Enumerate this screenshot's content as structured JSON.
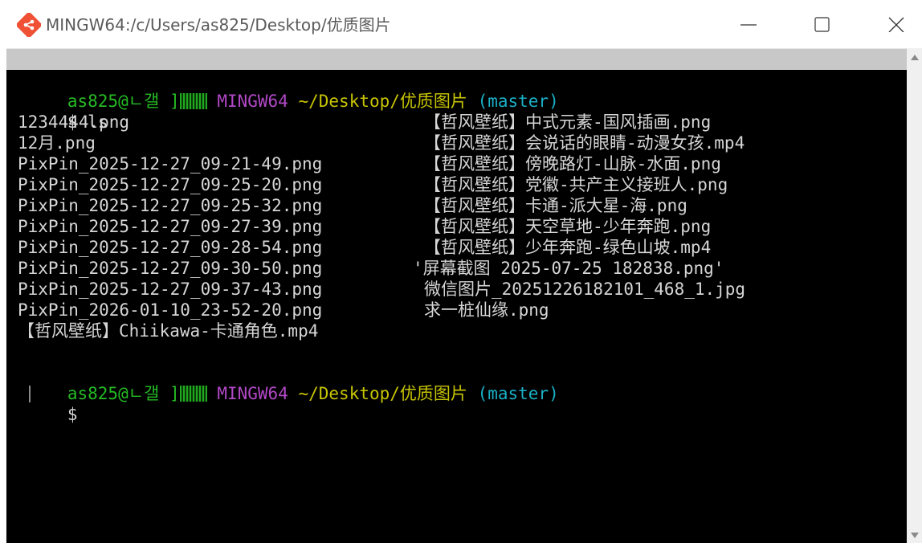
{
  "window": {
    "title": "MINGW64:/c/Users/as825/Desktop/优质图片"
  },
  "prompt": {
    "user_host": "as825@ㄴ갤 ]",
    "system": "MINGW64",
    "path": "~/Desktop/优质图片",
    "branch": "(master)",
    "symbol": "$"
  },
  "command": "ls",
  "listing": {
    "rows": [
      {
        "a": "1234444.png",
        "b": "【哲风壁纸】中式元素-国风插画.png"
      },
      {
        "a": "12月.png",
        "b": "【哲风壁纸】会说话的眼睛-动漫女孩.mp4"
      },
      {
        "a": "PixPin_2025-12-27_09-21-49.png",
        "b": "【哲风壁纸】傍晚路灯-山脉-水面.png"
      },
      {
        "a": "PixPin_2025-12-27_09-25-20.png",
        "b": "【哲风壁纸】党徽-共产主义接班人.png"
      },
      {
        "a": "PixPin_2025-12-27_09-25-32.png",
        "b": "【哲风壁纸】卡通-派大星-海.png"
      },
      {
        "a": "PixPin_2025-12-27_09-27-39.png",
        "b": "【哲风壁纸】天空草地-少年奔跑.png"
      },
      {
        "a": "PixPin_2025-12-27_09-28-54.png",
        "b": "【哲风壁纸】少年奔跑-绿色山坡.mp4"
      },
      {
        "a": "PixPin_2025-12-27_09-30-50.png",
        "b": "'屏幕截图 2025-07-25 182838.png'"
      },
      {
        "a": "PixPin_2025-12-27_09-37-43.png",
        "b": "微信图片_20251226182101_468_1.jpg"
      },
      {
        "a": "PixPin_2026-01-10_23-52-20.png",
        "b": "求一桩仙缘.png"
      },
      {
        "a": "【哲风壁纸】Chiikawa-卡通角色.mp4",
        "b": ""
      }
    ]
  },
  "icons": {
    "app": "git-bash-icon",
    "minimize": "minimize-icon",
    "maximize": "maximize-icon",
    "close": "close-icon"
  },
  "colors": {
    "prompt_user": "#25bc24",
    "prompt_system": "#b148c6",
    "prompt_path": "#c7c400",
    "prompt_branch": "#19b0c6",
    "terminal_bg": "#000000",
    "terminal_fg": "#d6d6d6"
  }
}
